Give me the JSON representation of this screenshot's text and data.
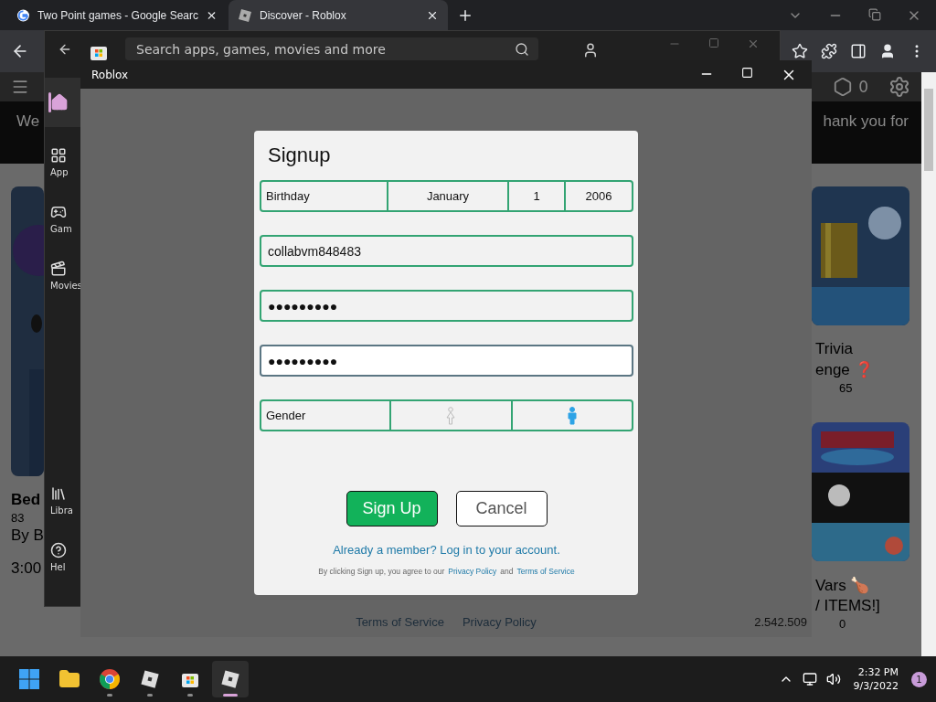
{
  "browser": {
    "tabs": [
      {
        "kind": "google",
        "title": "Two Point games - Google Searc",
        "selected": false
      },
      {
        "kind": "roblox",
        "title": "Discover - Roblox",
        "selected": true
      }
    ],
    "page": {
      "banner_left": "We",
      "banner_right": "hank you for",
      "robux": "0",
      "left_card": {
        "title": "Bed",
        "likes": "83",
        "creator": "By B",
        "time": "3:00"
      },
      "right_cards": [
        {
          "title_1": "Trivia",
          "title_2": "enge ❓",
          "players": "65"
        },
        {
          "title_1": "Vars 🍗",
          "title_2": "/ ITEMS!]",
          "players": "0"
        }
      ]
    }
  },
  "store_window": {
    "search": {
      "placeholder": "Search apps, games, movies and more"
    },
    "nav": [
      {
        "kind": "home",
        "selected": true
      },
      {
        "kind": "apps",
        "label": "App",
        "selected": false
      },
      {
        "kind": "games",
        "label": "Gam",
        "selected": false
      },
      {
        "kind": "movies",
        "label": "Movies",
        "selected": false
      },
      {
        "kind": "library",
        "label": "Libra",
        "selected": false
      },
      {
        "kind": "help",
        "label": "Hel",
        "selected": false
      }
    ]
  },
  "roblox_window": {
    "title": "Roblox",
    "signup": {
      "title": "Signup",
      "birthday": {
        "label": "Birthday",
        "month": "January",
        "day": "1",
        "year": "2006"
      },
      "fields": [
        {
          "value": "collabvm848483",
          "focused": false
        },
        {
          "value": "●●●●●●●●●",
          "focused": false
        },
        {
          "value": "●●●●●●●●●",
          "focused": true
        }
      ],
      "gender": {
        "label": "Gender",
        "options": [
          {
            "kind": "female",
            "selected": false
          },
          {
            "kind": "male",
            "selected": true
          }
        ]
      },
      "signup_button": "Sign Up",
      "cancel_button": "Cancel",
      "login_link": "Already a member? Log in to your account.",
      "terms": {
        "text": "By clicking Sign up, you agree to our",
        "privacy": "Privacy Policy",
        "and": "and",
        "tos": "Terms of Service"
      }
    },
    "footer_links": [
      "Terms of Service",
      "Privacy Policy"
    ],
    "version": "2.542.509"
  },
  "taskbar": {
    "apps": [
      {
        "kind": "start",
        "running": false,
        "selected": false
      },
      {
        "kind": "explorer",
        "running": false,
        "selected": false
      },
      {
        "kind": "chrome",
        "running": true,
        "selected": false
      },
      {
        "kind": "roblox",
        "running": true,
        "selected": false
      },
      {
        "kind": "store",
        "running": true,
        "selected": false
      },
      {
        "kind": "roblox",
        "running": true,
        "selected": true
      }
    ],
    "time": "2:32 PM",
    "date": "9/3/2022",
    "notifications": "1"
  }
}
